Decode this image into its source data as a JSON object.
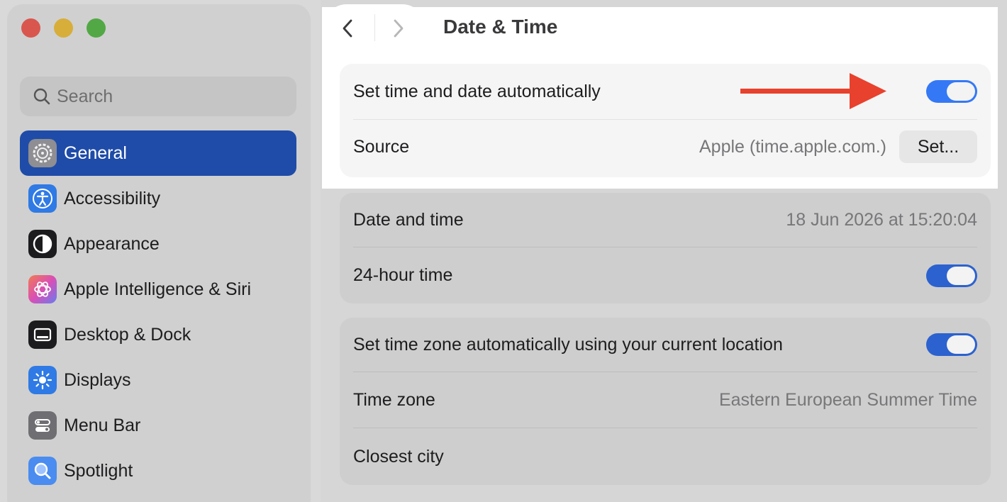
{
  "window": {
    "title": "Date & Time"
  },
  "sidebar": {
    "search_placeholder": "Search",
    "items": [
      {
        "label": "General",
        "icon": "gear-icon",
        "active": true
      },
      {
        "label": "Accessibility",
        "icon": "accessibility-icon"
      },
      {
        "label": "Appearance",
        "icon": "appearance-icon"
      },
      {
        "label": "Apple Intelligence & Siri",
        "icon": "siri-icon"
      },
      {
        "label": "Desktop & Dock",
        "icon": "dock-icon"
      },
      {
        "label": "Displays",
        "icon": "sun-icon"
      },
      {
        "label": "Menu Bar",
        "icon": "menu-bar-icon"
      },
      {
        "label": "Spotlight",
        "icon": "magnifier-icon"
      }
    ]
  },
  "settings": {
    "auto_time": {
      "label": "Set time and date automatically",
      "enabled": true
    },
    "source": {
      "label": "Source",
      "value": "Apple (time.apple.com.)",
      "button": "Set..."
    },
    "date_time": {
      "label": "Date and time",
      "value": "18 Jun 2026 at 15:20:04"
    },
    "hour24": {
      "label": "24-hour time",
      "enabled": true
    },
    "auto_zone": {
      "label": "Set time zone automatically using your current location",
      "enabled": true
    },
    "time_zone": {
      "label": "Time zone",
      "value": "Eastern European Summer Time"
    },
    "closest_city": {
      "label": "Closest city",
      "value": ""
    }
  },
  "colors": {
    "accent": "#3478f6",
    "sidebar_selection": "#1f4ca8",
    "annotation_arrow": "#e8412d"
  }
}
